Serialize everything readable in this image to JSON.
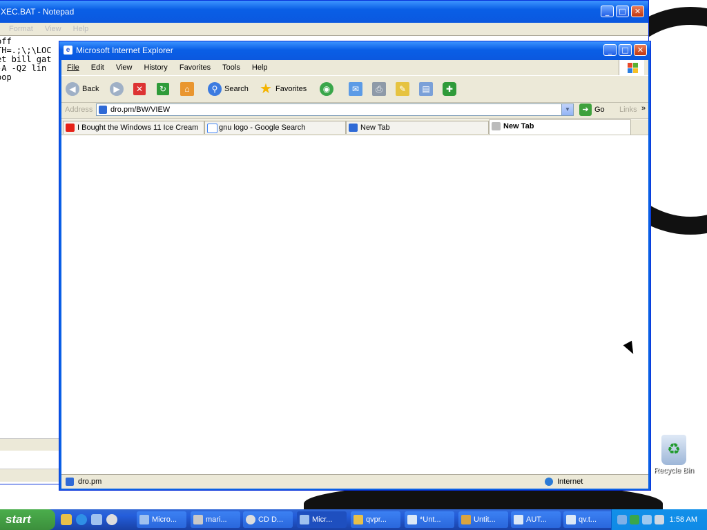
{
  "notepad": {
    "title": "XEC.BAT - Notepad",
    "menu": [
      "Format",
      "View",
      "Help"
    ],
    "lines": [
      "off",
      "TH=.;\\;\\LOC",
      "et bill gat",
      "",
      "-A -Q2 lin",
      "oop"
    ]
  },
  "ie": {
    "title": "Microsoft Internet Explorer",
    "menu": [
      "File",
      "Edit",
      "View",
      "History",
      "Favorites",
      "Tools",
      "Help"
    ],
    "toolbar": {
      "back": "Back",
      "search": "Search",
      "favorites": "Favorites"
    },
    "address": {
      "label": "Address",
      "url": "dro.pm/BW/VIEW",
      "go": "Go",
      "links": "Links",
      "chevron": "»"
    },
    "tabs": [
      {
        "label": "I Bought the Windows 11 Ice Cream",
        "icon": "youtube-icon"
      },
      {
        "label": "gnu logo - Google Search",
        "icon": "google-icon"
      },
      {
        "label": "New Tab",
        "icon": "ie-page-icon"
      },
      {
        "label": "New Tab",
        "icon": "hourglass-icon"
      }
    ],
    "status": {
      "left": "dro.pm",
      "zone": "Internet"
    }
  },
  "desktop": {
    "recycle_bin": "Recycle Bin"
  },
  "taskbar": {
    "start": "start",
    "tasks": [
      "Micro...",
      "mari...",
      "CD D...",
      "Micr...",
      "qvpr...",
      "*Unt...",
      "Untit...",
      "AUT...",
      "qv.t..."
    ],
    "clock": "1:58 AM"
  },
  "colors": {
    "xp_blue": "#0a5fe6",
    "start_green": "#3c8f3c"
  }
}
